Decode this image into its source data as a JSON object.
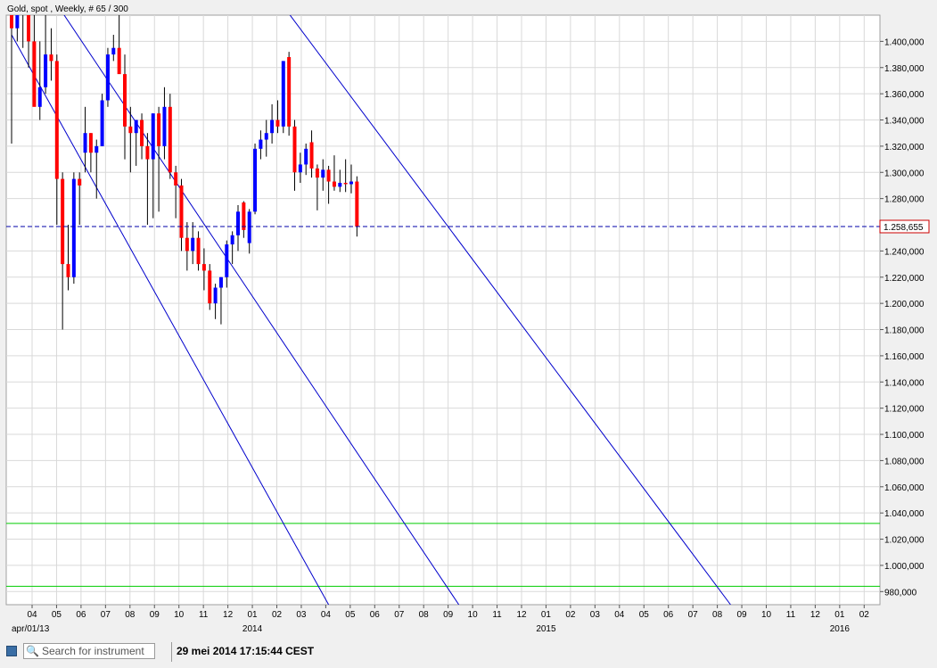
{
  "chart_data": {
    "type": "candlestick",
    "title": "Gold, spot , Weekly, # 65 / 300",
    "instrument": "Gold, spot",
    "timeframe": "Weekly",
    "last_price_label": "1.258,655",
    "last_price": 1258.655,
    "y_range": [
      970,
      1420
    ],
    "y_ticks": [
      {
        "v": 1400,
        "label": "1.400,000"
      },
      {
        "v": 1380,
        "label": "1.380,000"
      },
      {
        "v": 1360,
        "label": "1.360,000"
      },
      {
        "v": 1340,
        "label": "1.340,000"
      },
      {
        "v": 1320,
        "label": "1.320,000"
      },
      {
        "v": 1300,
        "label": "1.300,000"
      },
      {
        "v": 1280,
        "label": "1.280,000"
      },
      {
        "v": 1240,
        "label": "1.240,000"
      },
      {
        "v": 1220,
        "label": "1.220,000"
      },
      {
        "v": 1200,
        "label": "1.200,000"
      },
      {
        "v": 1180,
        "label": "1.180,000"
      },
      {
        "v": 1160,
        "label": "1.160,000"
      },
      {
        "v": 1140,
        "label": "1.140,000"
      },
      {
        "v": 1120,
        "label": "1.120,000"
      },
      {
        "v": 1100,
        "label": "1.100,000"
      },
      {
        "v": 1080,
        "label": "1.080,000"
      },
      {
        "v": 1060,
        "label": "1.060,000"
      },
      {
        "v": 1040,
        "label": "1.040,000"
      },
      {
        "v": 1020,
        "label": "1.020,000"
      },
      {
        "v": 1000,
        "label": "1.000,000"
      },
      {
        "v": 980,
        "label": "980,000"
      }
    ],
    "x_month_labels": [
      "04",
      "05",
      "06",
      "07",
      "08",
      "09",
      "10",
      "11",
      "12",
      "01",
      "02",
      "03",
      "04",
      "05",
      "06",
      "07",
      "08",
      "09",
      "10",
      "11",
      "12",
      "01",
      "02",
      "03",
      "04",
      "05",
      "06",
      "07",
      "08",
      "09",
      "10",
      "11",
      "12",
      "01",
      "02"
    ],
    "x_year_labels": [
      {
        "month_index": 0,
        "label": "apr/01/13"
      },
      {
        "month_index": 9,
        "label": "2014"
      },
      {
        "month_index": 21,
        "label": "2015"
      },
      {
        "month_index": 33,
        "label": "2016"
      }
    ],
    "candles": [
      {
        "o": 1440,
        "h": 1445,
        "l": 1322,
        "c": 1410
      },
      {
        "o": 1410,
        "h": 1440,
        "l": 1400,
        "c": 1420
      },
      {
        "o": 1420,
        "h": 1450,
        "l": 1395,
        "c": 1430
      },
      {
        "o": 1430,
        "h": 1440,
        "l": 1380,
        "c": 1400
      },
      {
        "o": 1400,
        "h": 1420,
        "l": 1360,
        "c": 1350
      },
      {
        "o": 1350,
        "h": 1400,
        "l": 1340,
        "c": 1365
      },
      {
        "o": 1365,
        "h": 1420,
        "l": 1360,
        "c": 1390
      },
      {
        "o": 1390,
        "h": 1410,
        "l": 1370,
        "c": 1385
      },
      {
        "o": 1385,
        "h": 1390,
        "l": 1260,
        "c": 1295
      },
      {
        "o": 1295,
        "h": 1300,
        "l": 1180,
        "c": 1230
      },
      {
        "o": 1230,
        "h": 1260,
        "l": 1210,
        "c": 1220
      },
      {
        "o": 1220,
        "h": 1300,
        "l": 1215,
        "c": 1295
      },
      {
        "o": 1295,
        "h": 1300,
        "l": 1260,
        "c": 1290
      },
      {
        "o": 1315,
        "h": 1350,
        "l": 1300,
        "c": 1330
      },
      {
        "o": 1330,
        "h": 1330,
        "l": 1300,
        "c": 1315
      },
      {
        "o": 1315,
        "h": 1325,
        "l": 1280,
        "c": 1320
      },
      {
        "o": 1320,
        "h": 1360,
        "l": 1320,
        "c": 1355
      },
      {
        "o": 1355,
        "h": 1395,
        "l": 1350,
        "c": 1390
      },
      {
        "o": 1390,
        "h": 1405,
        "l": 1385,
        "c": 1395
      },
      {
        "o": 1395,
        "h": 1425,
        "l": 1385,
        "c": 1375
      },
      {
        "o": 1375,
        "h": 1390,
        "l": 1310,
        "c": 1335
      },
      {
        "o": 1335,
        "h": 1350,
        "l": 1300,
        "c": 1330
      },
      {
        "o": 1330,
        "h": 1340,
        "l": 1305,
        "c": 1340
      },
      {
        "o": 1340,
        "h": 1345,
        "l": 1310,
        "c": 1320
      },
      {
        "o": 1320,
        "h": 1330,
        "l": 1260,
        "c": 1310
      },
      {
        "o": 1310,
        "h": 1345,
        "l": 1265,
        "c": 1345
      },
      {
        "o": 1345,
        "h": 1350,
        "l": 1270,
        "c": 1320
      },
      {
        "o": 1320,
        "h": 1365,
        "l": 1310,
        "c": 1350
      },
      {
        "o": 1350,
        "h": 1360,
        "l": 1295,
        "c": 1300
      },
      {
        "o": 1300,
        "h": 1305,
        "l": 1265,
        "c": 1290
      },
      {
        "o": 1290,
        "h": 1295,
        "l": 1240,
        "c": 1250
      },
      {
        "o": 1250,
        "h": 1262,
        "l": 1225,
        "c": 1240
      },
      {
        "o": 1240,
        "h": 1262,
        "l": 1230,
        "c": 1250
      },
      {
        "o": 1250,
        "h": 1255,
        "l": 1225,
        "c": 1230
      },
      {
        "o": 1230,
        "h": 1242,
        "l": 1210,
        "c": 1225
      },
      {
        "o": 1225,
        "h": 1230,
        "l": 1195,
        "c": 1200
      },
      {
        "o": 1200,
        "h": 1215,
        "l": 1188,
        "c": 1212
      },
      {
        "o": 1212,
        "h": 1220,
        "l": 1184,
        "c": 1220
      },
      {
        "o": 1220,
        "h": 1248,
        "l": 1212,
        "c": 1245
      },
      {
        "o": 1245,
        "h": 1255,
        "l": 1230,
        "c": 1252
      },
      {
        "o": 1252,
        "h": 1275,
        "l": 1240,
        "c": 1270
      },
      {
        "o": 1277,
        "h": 1278,
        "l": 1250,
        "c": 1256
      },
      {
        "o": 1246,
        "h": 1272,
        "l": 1238,
        "c": 1270
      },
      {
        "o": 1270,
        "h": 1322,
        "l": 1268,
        "c": 1318
      },
      {
        "o": 1318,
        "h": 1332,
        "l": 1310,
        "c": 1325
      },
      {
        "o": 1325,
        "h": 1340,
        "l": 1312,
        "c": 1330
      },
      {
        "o": 1330,
        "h": 1352,
        "l": 1322,
        "c": 1340
      },
      {
        "o": 1340,
        "h": 1355,
        "l": 1330,
        "c": 1335
      },
      {
        "o": 1335,
        "h": 1385,
        "l": 1330,
        "c": 1385
      },
      {
        "o": 1388,
        "h": 1392,
        "l": 1328,
        "c": 1335
      },
      {
        "o": 1335,
        "h": 1340,
        "l": 1286,
        "c": 1300
      },
      {
        "o": 1300,
        "h": 1315,
        "l": 1292,
        "c": 1306
      },
      {
        "o": 1306,
        "h": 1322,
        "l": 1298,
        "c": 1318
      },
      {
        "o": 1323,
        "h": 1332,
        "l": 1296,
        "c": 1303
      },
      {
        "o": 1303,
        "h": 1306,
        "l": 1271,
        "c": 1296
      },
      {
        "o": 1296,
        "h": 1310,
        "l": 1286,
        "c": 1302
      },
      {
        "o": 1302,
        "h": 1305,
        "l": 1276,
        "c": 1293
      },
      {
        "o": 1293,
        "h": 1313,
        "l": 1286,
        "c": 1289
      },
      {
        "o": 1289,
        "h": 1302,
        "l": 1285,
        "c": 1292
      },
      {
        "o": 1292,
        "h": 1310,
        "l": 1285,
        "c": 1291
      },
      {
        "o": 1291,
        "h": 1306,
        "l": 1284,
        "c": 1293
      },
      {
        "o": 1293,
        "h": 1297,
        "l": 1251,
        "c": 1258.655
      }
    ],
    "trend_lines": [
      {
        "x1_week": 0,
        "y1": 1405,
        "x2_week": 56,
        "y2": 970
      },
      {
        "x1_week": 0,
        "y1": 1480,
        "x2_week": 79,
        "y2": 970
      },
      {
        "x1_week": 44,
        "y1": 1450,
        "x2_week": 127,
        "y2": 970
      }
    ],
    "horizontal_levels": [
      {
        "value": 1032,
        "color": "#00cc00"
      },
      {
        "value": 984,
        "color": "#00cc00"
      }
    ],
    "colors": {
      "up": "#0000ff",
      "down": "#ff0000",
      "wick": "#000000",
      "trend": "#0000cc",
      "price_line": "#0000aa",
      "grid": "#d9d9d9",
      "price_box_border": "#cc0000"
    }
  },
  "status_bar": {
    "search_placeholder": "Search for instrument",
    "timestamp": "29 mei 2014 17:15:44 CEST"
  }
}
